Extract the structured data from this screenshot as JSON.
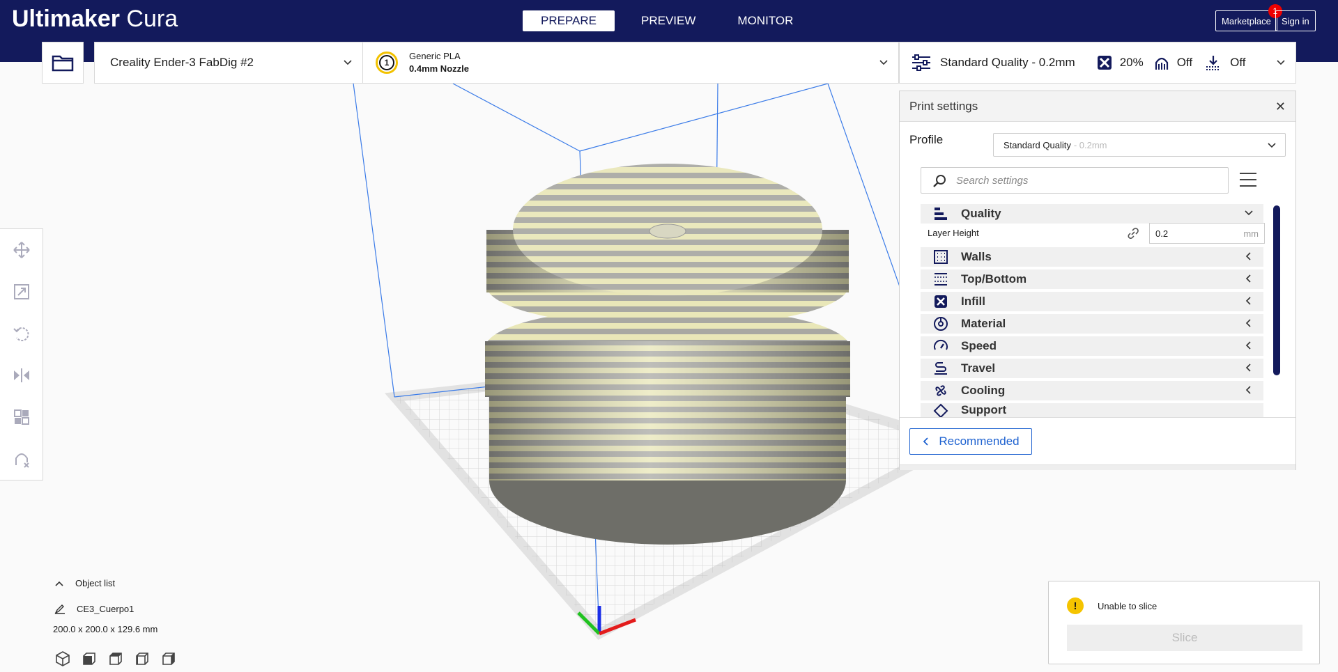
{
  "app": {
    "logo_bold": "Ultimaker",
    "logo_light": " Cura"
  },
  "stages": [
    {
      "label": "PREPARE"
    },
    {
      "label": "PREVIEW"
    },
    {
      "label": "MONITOR"
    }
  ],
  "header": {
    "marketplace": "Marketplace",
    "marketplace_badge": "1",
    "sign_in": "Sign in"
  },
  "printer": {
    "name": "Creality Ender-3 FabDig #2"
  },
  "material": {
    "extruder": "1",
    "name": "Generic PLA",
    "nozzle": "0.4mm Nozzle"
  },
  "settings_summary": {
    "profile": "Standard Quality - 0.2mm",
    "infill": "20%",
    "support": "Off",
    "adhesion": "Off"
  },
  "print_settings": {
    "title": "Print settings",
    "profile_label": "Profile",
    "profile_value": "Standard Quality",
    "profile_layer": "- 0.2mm",
    "search_placeholder": "Search settings",
    "layer_height_label": "Layer Height",
    "layer_height_value": "0.2",
    "layer_height_unit": "mm",
    "categories": [
      {
        "label": "Quality",
        "icon": "quality-icon"
      },
      {
        "label": "Walls",
        "icon": "walls-icon"
      },
      {
        "label": "Top/Bottom",
        "icon": "top-bottom-icon"
      },
      {
        "label": "Infill",
        "icon": "infill-icon"
      },
      {
        "label": "Material",
        "icon": "material-icon"
      },
      {
        "label": "Speed",
        "icon": "speed-icon"
      },
      {
        "label": "Travel",
        "icon": "travel-icon"
      },
      {
        "label": "Cooling",
        "icon": "cooling-icon"
      },
      {
        "label": "Support",
        "icon": "support-icon"
      }
    ],
    "recommended_button": "Recommended"
  },
  "object_list": {
    "title": "Object list",
    "object_name": "CE3_Cuerpo1",
    "dimensions": "200.0 x 200.0 x 129.6 mm"
  },
  "slice": {
    "message": "Unable to slice",
    "button": "Slice"
  }
}
